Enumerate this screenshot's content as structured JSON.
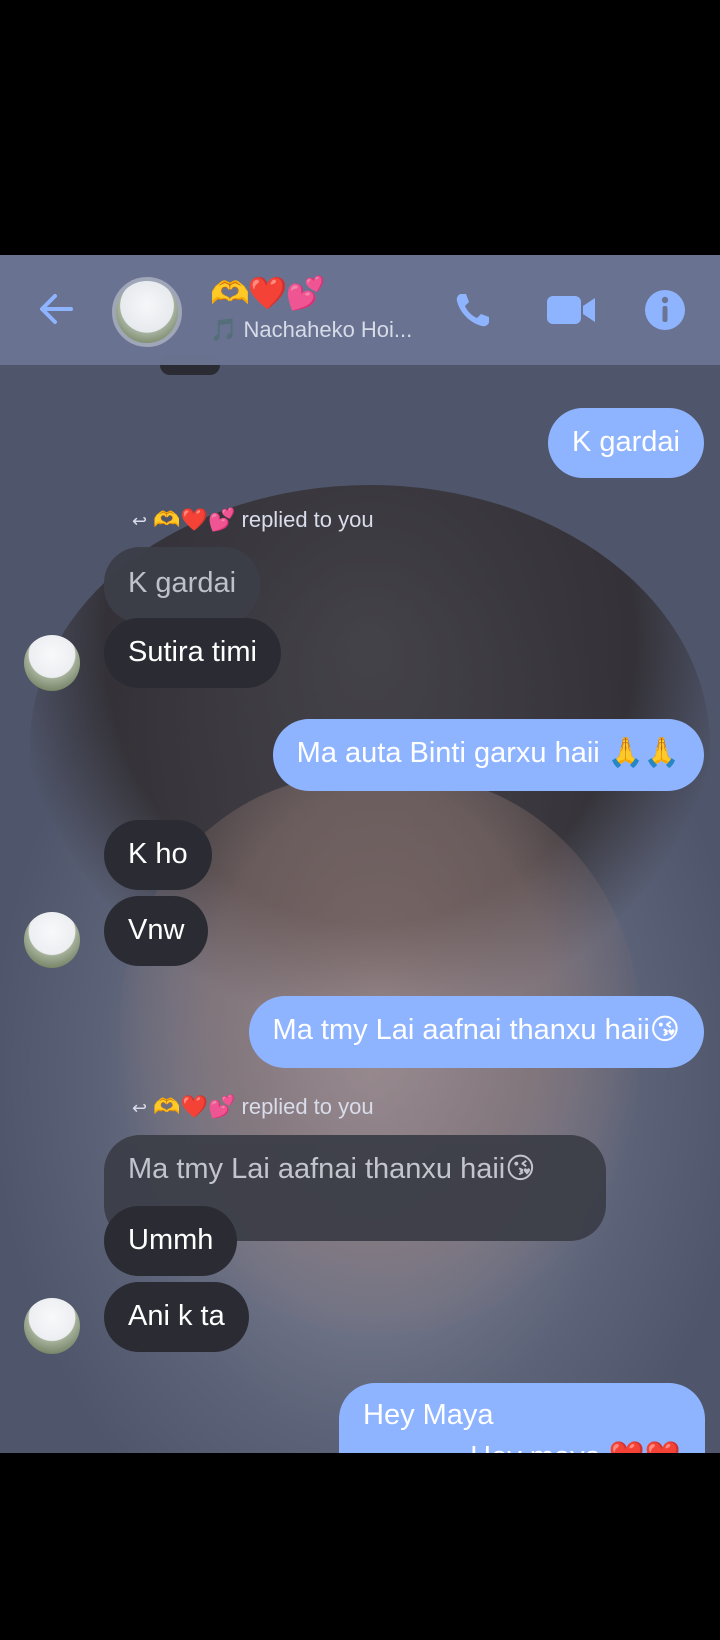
{
  "header": {
    "contact_emojis": "🫶❤️💕",
    "now_playing": "🎵 Nachaheko Hoi...",
    "back_icon": "arrow-left-icon",
    "call_icon": "phone-icon",
    "video_icon": "video-icon",
    "info_icon": "info-icon",
    "accent_color": "#8fb4ff"
  },
  "messages": {
    "m1": "K gardai",
    "reply1_note": "🫶❤️💕 replied to you",
    "reply1_quote": "K gardai",
    "m2": "Sutira timi",
    "m3": "Ma auta Binti garxu haii 🙏🙏",
    "m4": "K ho",
    "m5": "Vnw",
    "m6": "Ma tmy Lai aafnai thanxu haii😘",
    "reply2_note": "🫶❤️💕 replied to you",
    "reply2_quote": "Ma tmy Lai aafnai thanxu haii😘",
    "m7": "Ummh",
    "m8": "Ani k ta",
    "m9_line1": "Hey Maya",
    "m9_line2": "Hey maya ❤️❤️"
  }
}
